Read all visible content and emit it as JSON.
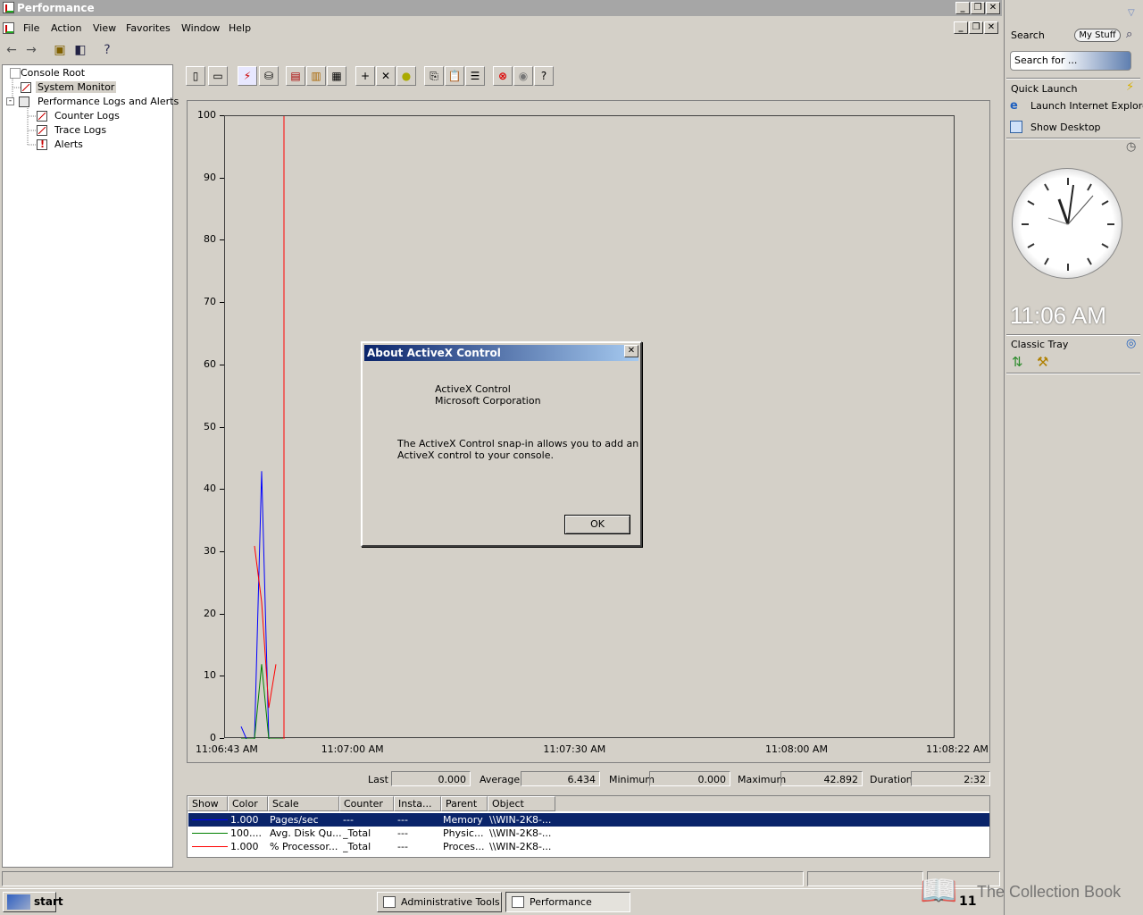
{
  "window": {
    "title": "Performance",
    "caption_buttons": [
      "minimize",
      "restore",
      "close"
    ]
  },
  "menu": [
    "File",
    "Action",
    "View",
    "Favorites",
    "Window",
    "Help"
  ],
  "tree": {
    "root": "Console Root",
    "system_monitor": "System Monitor",
    "perf_logs": "Performance Logs and Alerts",
    "counter_logs": "Counter Logs",
    "trace_logs": "Trace Logs",
    "alerts": "Alerts"
  },
  "chart_data": {
    "type": "line",
    "ylim": [
      0,
      100
    ],
    "yticks": [
      "0",
      "10",
      "20",
      "30",
      "40",
      "50",
      "60",
      "70",
      "80",
      "90",
      "100"
    ],
    "xticks": [
      "11:06:43 AM",
      "11:07:00 AM",
      "11:07:30 AM",
      "11:08:00 AM",
      "11:08:22 AM"
    ],
    "current_time_marker_color": "#ff0000",
    "series": [
      {
        "color": "#0000ff",
        "values": [
          2,
          0,
          0,
          43,
          0,
          0,
          0
        ]
      },
      {
        "color": "#008000",
        "values": [
          0,
          0,
          0,
          12,
          0,
          0,
          0
        ]
      },
      {
        "color": "#ff0000",
        "values": [
          null,
          null,
          31,
          22,
          5,
          12,
          null
        ]
      }
    ]
  },
  "stats": {
    "last_label": "Last",
    "last": "0.000",
    "avg_label": "Average",
    "avg": "6.434",
    "min_label": "Minimum",
    "min": "0.000",
    "max_label": "Maximum",
    "max": "42.892",
    "dur_label": "Duration",
    "dur": "2:32"
  },
  "counters": {
    "headers": [
      "Show",
      "Color",
      "Scale",
      "Counter",
      "Insta...",
      "Parent",
      "Object"
    ],
    "rows": [
      {
        "color": "#0000ff",
        "scale": "1.000",
        "counter": "Pages/sec",
        "instance": "---",
        "parent": "---",
        "object": "Memory",
        "computer": "\\\\WIN-2K8-..."
      },
      {
        "color": "#008000",
        "scale": "100....",
        "counter": "Avg. Disk Qu...",
        "instance": "_Total",
        "parent": "---",
        "object": "Physic...",
        "computer": "\\\\WIN-2K8-..."
      },
      {
        "color": "#ff0000",
        "scale": "1.000",
        "counter": "% Processor...",
        "instance": "_Total",
        "parent": "---",
        "object": "Proces...",
        "computer": "\\\\WIN-2K8-..."
      }
    ]
  },
  "dialog": {
    "title": "About ActiveX Control",
    "line1": "ActiveX Control",
    "line2": "Microsoft Corporation",
    "desc1": "The ActiveX Control snap-in allows you to add an",
    "desc2": "ActiveX control to your console.",
    "ok": "OK"
  },
  "taskbar": {
    "start": "start",
    "tasks": [
      "Administrative Tools",
      "Performance"
    ],
    "clock": "11"
  },
  "sidebar": {
    "search_label": "Search",
    "mystuff": "My Stuff",
    "search_placeholder": "Search for ...",
    "quick_launch": "Quick Launch",
    "launch_ie": "Launch Internet Explore",
    "show_desktop": "Show Desktop",
    "time": "11:06 AM",
    "classic_tray": "Classic Tray"
  },
  "watermark": "The Collection Book"
}
